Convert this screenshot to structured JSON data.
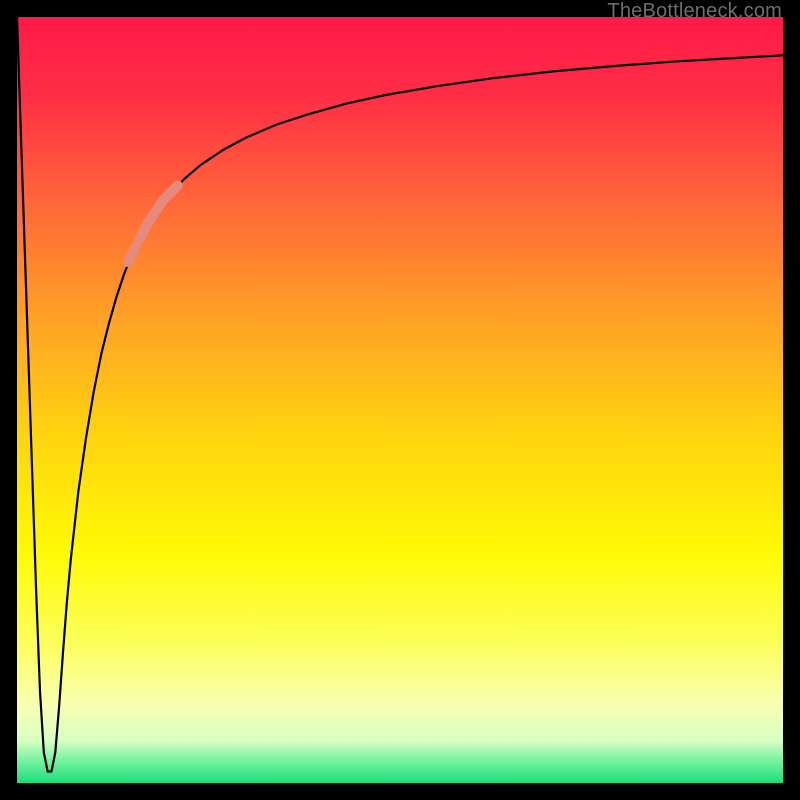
{
  "watermark": "TheBottleneck.com",
  "chart_data": {
    "type": "line",
    "title": "",
    "xlabel": "",
    "ylabel": "",
    "xlim": [
      0,
      100
    ],
    "ylim": [
      0,
      100
    ],
    "grid": false,
    "legend": false,
    "gradient_stops": [
      {
        "pos": 0.0,
        "color": "#ff1a47"
      },
      {
        "pos": 0.1,
        "color": "#ff2d46"
      },
      {
        "pos": 0.25,
        "color": "#ff6a38"
      },
      {
        "pos": 0.4,
        "color": "#ffa424"
      },
      {
        "pos": 0.55,
        "color": "#ffd50f"
      },
      {
        "pos": 0.7,
        "color": "#fffa05"
      },
      {
        "pos": 0.82,
        "color": "#fcff5e"
      },
      {
        "pos": 0.9,
        "color": "#f8ffb4"
      },
      {
        "pos": 0.945,
        "color": "#d7ffc3"
      },
      {
        "pos": 0.97,
        "color": "#7af2a0"
      },
      {
        "pos": 1.0,
        "color": "#18e07a"
      }
    ],
    "series": [
      {
        "name": "bottleneck-curve",
        "color": "#000000",
        "stroke_width": 2.2,
        "x": [
          0.0,
          0.5,
          1.0,
          1.5,
          2.0,
          2.5,
          3.0,
          3.5,
          4.0,
          4.5,
          5.0,
          5.5,
          6.0,
          6.5,
          7.0,
          8.0,
          9.0,
          10.0,
          11.0,
          12.0,
          13.0,
          14.0,
          15.0,
          16.0,
          18.0,
          20.0,
          22.0,
          24.0,
          27.0,
          30.0,
          34.0,
          38.0,
          43.0,
          48.0,
          55.0,
          62.0,
          70.0,
          78.0,
          86.0,
          93.0,
          100.0
        ],
        "y": [
          100.0,
          85.0,
          70.0,
          55.0,
          40.0,
          25.0,
          12.0,
          4.0,
          1.5,
          1.5,
          4.0,
          10.0,
          17.0,
          23.5,
          29.0,
          38.0,
          45.0,
          51.0,
          56.0,
          60.0,
          63.5,
          66.5,
          69.0,
          71.0,
          74.5,
          77.0,
          79.0,
          80.7,
          82.7,
          84.3,
          86.0,
          87.3,
          88.7,
          89.8,
          91.0,
          92.0,
          92.9,
          93.6,
          94.2,
          94.6,
          95.0
        ]
      },
      {
        "name": "highlight-segment-long",
        "color": "#e78a7e",
        "stroke_width": 10,
        "x": [
          16.0,
          17.0,
          18.0,
          19.0,
          20.0,
          21.0
        ],
        "y": [
          71.0,
          73.0,
          74.5,
          76.0,
          77.0,
          78.0
        ]
      },
      {
        "name": "highlight-segment-dot",
        "color": "#e78a7e",
        "stroke_width": 10,
        "x": [
          14.5,
          15.5
        ],
        "y": [
          68.0,
          70.0
        ]
      }
    ]
  }
}
